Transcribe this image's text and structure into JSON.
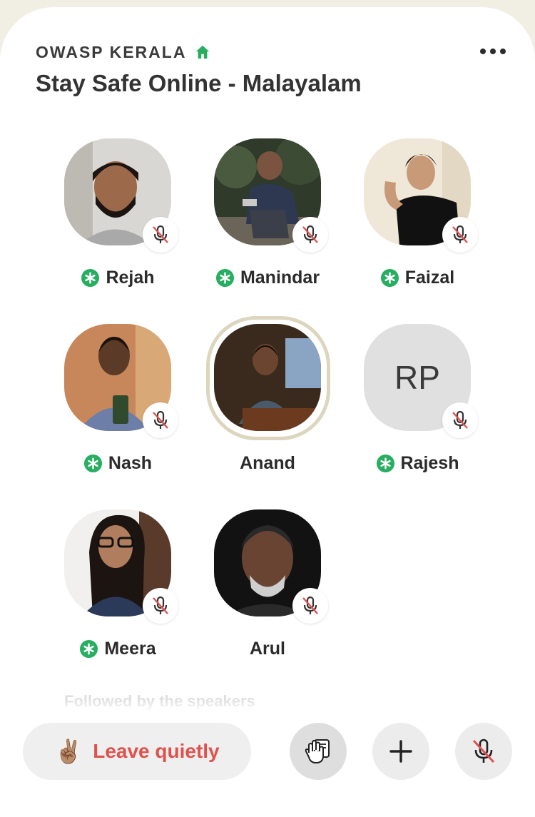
{
  "header": {
    "club_name": "OWASP KERALA",
    "room_title": "Stay Safe Online - Malayalam"
  },
  "speakers": [
    {
      "name": "Rejah",
      "moderator": true,
      "muted": true,
      "avatar": "photo"
    },
    {
      "name": "Manindar",
      "moderator": true,
      "muted": true,
      "avatar": "photo"
    },
    {
      "name": "Faizal",
      "moderator": true,
      "muted": true,
      "avatar": "photo"
    },
    {
      "name": "Nash",
      "moderator": true,
      "muted": true,
      "avatar": "photo"
    },
    {
      "name": "Anand",
      "moderator": false,
      "muted": false,
      "speaking": true,
      "avatar": "photo"
    },
    {
      "name": "Rajesh",
      "moderator": true,
      "muted": true,
      "avatar": "initials",
      "initials": "RP"
    },
    {
      "name": "Meera",
      "moderator": true,
      "muted": true,
      "avatar": "photo"
    },
    {
      "name": "Arul",
      "moderator": false,
      "muted": true,
      "avatar": "photo"
    }
  ],
  "section": {
    "followed_label": "Followed by the speakers"
  },
  "bottom_bar": {
    "leave_emoji": "✌🏽",
    "leave_label": "Leave quietly",
    "actions": [
      "raise-hand",
      "add",
      "mic-muted"
    ]
  },
  "colors": {
    "accent_green": "#27ae60",
    "leave_red": "#e0514b",
    "mute_red": "#e25050",
    "background": "#f1efe4"
  }
}
